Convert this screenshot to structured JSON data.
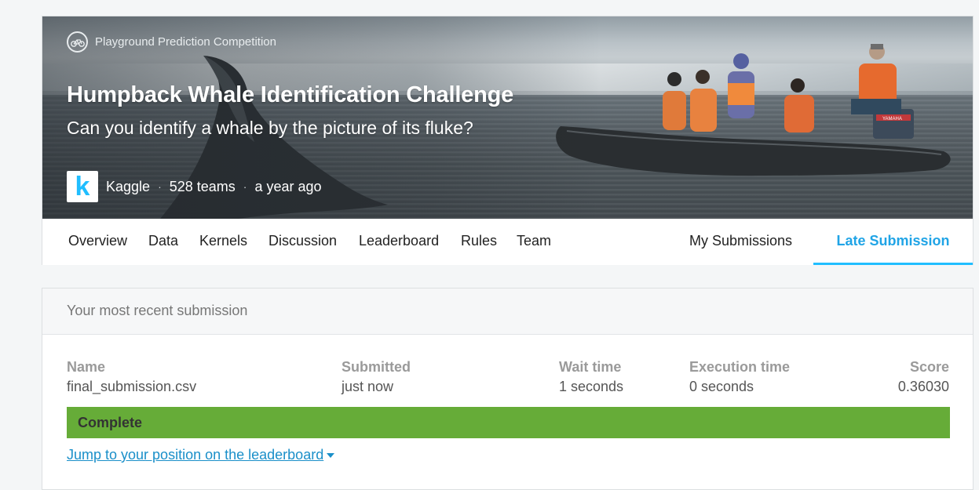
{
  "competition": {
    "type_label": "Playground Prediction Competition",
    "type_icon": "bicycle-icon",
    "title": "Humpback Whale Identification Challenge",
    "subtitle": "Can you identify a whale by the picture of its fluke?",
    "host_logo_letter": "k",
    "host_name": "Kaggle",
    "separator": "·",
    "teams": "528 teams",
    "when": "a year ago",
    "boat_brand": "YAMAHA",
    "accent_color": "#20beff"
  },
  "tabs": {
    "left": [
      "Overview",
      "Data",
      "Kernels",
      "Discussion",
      "Leaderboard",
      "Rules",
      "Team"
    ],
    "my_submissions": "My Submissions",
    "late_submission": "Late Submission",
    "active": "Late Submission"
  },
  "submission": {
    "heading": "Your most recent submission",
    "columns": {
      "name": {
        "label": "Name",
        "value": "final_submission.csv"
      },
      "submitted": {
        "label": "Submitted",
        "value": "just now"
      },
      "wait": {
        "label": "Wait time",
        "value": "1 seconds"
      },
      "execution": {
        "label": "Execution time",
        "value": "0 seconds"
      },
      "score": {
        "label": "Score",
        "value": "0.36030"
      }
    },
    "status": "Complete",
    "status_color": "#66ac38",
    "jump_link": "Jump to your position on the leaderboard"
  }
}
